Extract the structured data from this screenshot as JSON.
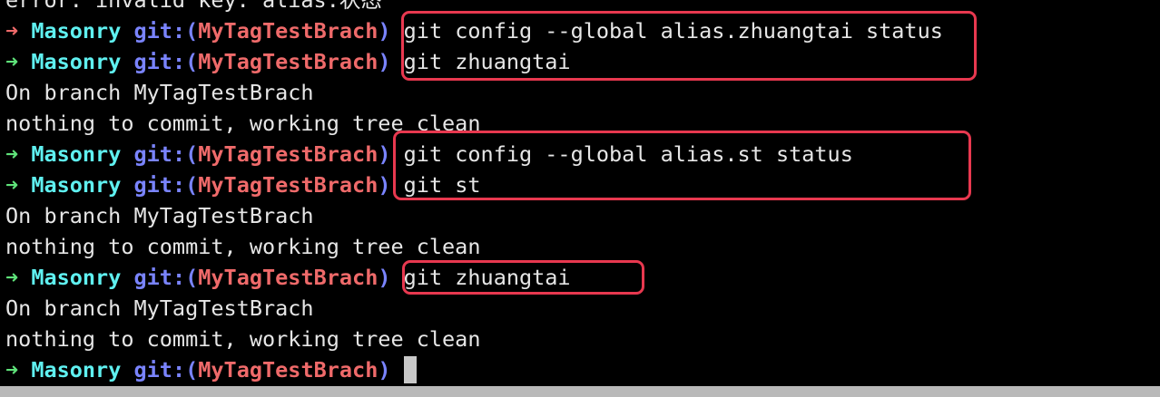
{
  "terminal": {
    "prompt": {
      "arrow": "➜",
      "directory": "Masonry",
      "git_label": "git:(",
      "branch": "MyTagTestBrach",
      "git_close": ")"
    },
    "lines": [
      {
        "type": "output",
        "text": "error: invalid key: alias.状态"
      },
      {
        "type": "prompt",
        "status": "fail",
        "command": "git config --global alias.zhuangtai status"
      },
      {
        "type": "prompt",
        "status": "ok",
        "command": "git zhuangtai"
      },
      {
        "type": "output",
        "text": "On branch MyTagTestBrach"
      },
      {
        "type": "output",
        "text": "nothing to commit, working tree clean"
      },
      {
        "type": "prompt",
        "status": "ok",
        "command": "git config --global alias.st status"
      },
      {
        "type": "prompt",
        "status": "ok",
        "command": "git st"
      },
      {
        "type": "output",
        "text": "On branch MyTagTestBrach"
      },
      {
        "type": "output",
        "text": "nothing to commit, working tree clean"
      },
      {
        "type": "prompt",
        "status": "ok",
        "command": "git zhuangtai"
      },
      {
        "type": "output",
        "text": "On branch MyTagTestBrach"
      },
      {
        "type": "output",
        "text": "nothing to commit, working tree clean"
      },
      {
        "type": "prompt",
        "status": "ok",
        "command": ""
      }
    ]
  },
  "colors": {
    "background": "#000000",
    "arrow_ok": "#5fe37a",
    "arrow_fail": "#ef6a6a",
    "directory": "#5ff0f0",
    "git_label": "#7a84ff",
    "branch": "#ef6a6a",
    "annotation_box": "#e8384f"
  }
}
